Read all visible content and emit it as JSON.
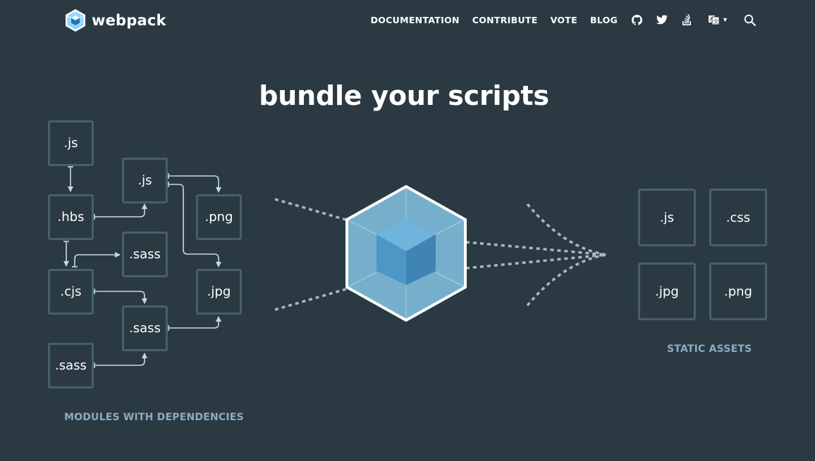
{
  "header": {
    "logo_text": "webpack",
    "nav": [
      "DOCUMENTATION",
      "CONTRIBUTE",
      "VOTE",
      "BLOG"
    ],
    "icons": [
      "github-icon",
      "twitter-icon",
      "stackoverflow-icon",
      "language-icon",
      "search-icon"
    ]
  },
  "hero": {
    "headline": "bundle your scripts",
    "modules": [
      ".js",
      ".js",
      ".hbs",
      ".png",
      ".sass",
      ".cjs",
      ".jpg",
      ".sass",
      ".sass"
    ],
    "modules_caption": "MODULES WITH DEPENDENCIES",
    "assets": [
      ".js",
      ".css",
      ".jpg",
      ".png"
    ],
    "assets_caption": "STATIC ASSETS"
  },
  "colors": {
    "background": "#2b3a42",
    "box_border": "#46606d",
    "arrow": "#c2d9e8",
    "caption": "#8eabc2",
    "cube_outer": "#75afcc",
    "cube_inner": "#4d97c6"
  }
}
